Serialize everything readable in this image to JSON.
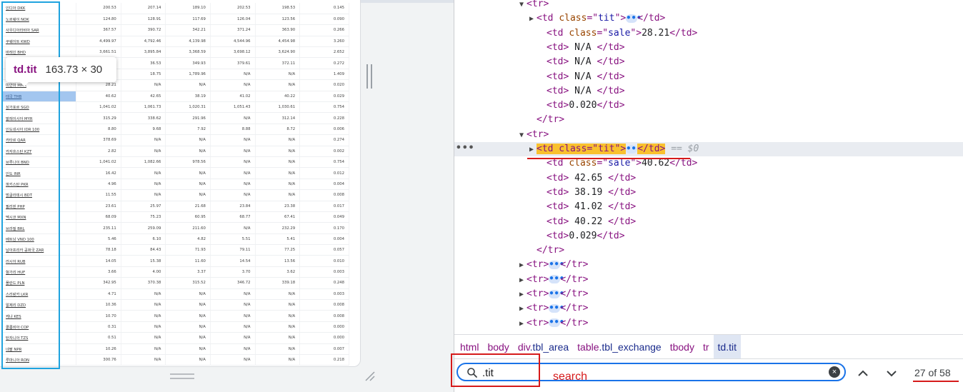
{
  "viewport": {
    "tooltip": {
      "tag": "td.tit",
      "dims": "163.73 × 30"
    },
    "rows": [
      [
        "인디아 DKK",
        "200.53",
        "207.14",
        "189.10",
        "202.53",
        "198.53",
        "0.145"
      ],
      [
        "노르웨이 NOK",
        "124.80",
        "128.91",
        "117.69",
        "126.04",
        "123.56",
        "0.090"
      ],
      [
        "사우디아라비아 SAR",
        "367.57",
        "390.72",
        "342.21",
        "371.24",
        "363.90",
        "0.266"
      ],
      [
        "쿠웨이트 KWD",
        "4,499.97",
        "4,792.46",
        "4,139.98",
        "4,544.96",
        "4,454.98",
        "3.260"
      ],
      [
        "바레인 BHD",
        "3,661.51",
        "3,895.84",
        "3,368.59",
        "3,698.12",
        "3,624.90",
        "2.652"
      ],
      [
        "",
        "",
        "36.53",
        "349.93",
        "379.61",
        "372.11",
        "0.272"
      ],
      [
        "",
        "",
        "18.75",
        "1,789.96",
        "N/A",
        "N/A",
        "1.409"
      ],
      [
        "미얀마 MMK",
        "28.21",
        "N/A",
        "N/A",
        "N/A",
        "N/A",
        "0.020"
      ],
      [
        "태국 THB",
        "40.62",
        "42.65",
        "38.19",
        "41.02",
        "40.22",
        "0.029"
      ],
      [
        "싱가포르 SGD",
        "1,041.02",
        "1,061.73",
        "1,020.31",
        "1,051.43",
        "1,030.61",
        "0.754"
      ],
      [
        "말레이시아 MYR",
        "315.29",
        "338.62",
        "291.96",
        "N/A",
        "312.14",
        "0.228"
      ],
      [
        "인도네시아 IDR 100",
        "8.80",
        "9.68",
        "7.92",
        "8.88",
        "8.72",
        "0.006"
      ],
      [
        "카타르 QAR",
        "378.69",
        "N/A",
        "N/A",
        "N/A",
        "N/A",
        "0.274"
      ],
      [
        "카자흐스탄 KZT",
        "2.82",
        "N/A",
        "N/A",
        "N/A",
        "N/A",
        "0.002"
      ],
      [
        "브루나이 BND",
        "1,041.02",
        "1,082.66",
        "978.56",
        "N/A",
        "N/A",
        "0.754"
      ],
      [
        "인도 INR",
        "16.42",
        "N/A",
        "N/A",
        "N/A",
        "N/A",
        "0.012"
      ],
      [
        "파키스탄 PKR",
        "4.96",
        "N/A",
        "N/A",
        "N/A",
        "N/A",
        "0.004"
      ],
      [
        "방글라데시 BDT",
        "11.55",
        "N/A",
        "N/A",
        "N/A",
        "N/A",
        "0.008"
      ],
      [
        "필리핀 PHP",
        "23.61",
        "25.97",
        "21.68",
        "23.84",
        "23.38",
        "0.017"
      ],
      [
        "멕시코 MXN",
        "68.09",
        "75.23",
        "60.95",
        "68.77",
        "67.41",
        "0.049"
      ],
      [
        "브라질 BRL",
        "235.11",
        "259.09",
        "211.60",
        "N/A",
        "232.29",
        "0.170"
      ],
      [
        "베트남 VND 100",
        "5.46",
        "6.10",
        "4.82",
        "5.51",
        "5.41",
        "0.004"
      ],
      [
        "남아프리카 공화국 ZAR",
        "78.18",
        "84.43",
        "71.93",
        "79.11",
        "77.25",
        "0.057"
      ],
      [
        "러시아 RUB",
        "14.05",
        "15.38",
        "11.60",
        "14.54",
        "13.56",
        "0.010"
      ],
      [
        "헝가리 HUF",
        "3.66",
        "4.00",
        "3.37",
        "3.70",
        "3.62",
        "0.003"
      ],
      [
        "폴란드 PLN",
        "342.95",
        "370.38",
        "315.52",
        "346.72",
        "339.18",
        "0.248"
      ],
      [
        "스리랑카 LKR",
        "4.71",
        "N/A",
        "N/A",
        "N/A",
        "N/A",
        "0.003"
      ],
      [
        "알제리 DZD",
        "10.36",
        "N/A",
        "N/A",
        "N/A",
        "N/A",
        "0.008"
      ],
      [
        "케냐 KES",
        "10.70",
        "N/A",
        "N/A",
        "N/A",
        "N/A",
        "0.008"
      ],
      [
        "콜롬비아 COP",
        "0.31",
        "N/A",
        "N/A",
        "N/A",
        "N/A",
        "0.000"
      ],
      [
        "탄자니아 TZS",
        "0.51",
        "N/A",
        "N/A",
        "N/A",
        "N/A",
        "0.000"
      ],
      [
        "네팔 NPR",
        "10.26",
        "N/A",
        "N/A",
        "N/A",
        "N/A",
        "0.007"
      ],
      [
        "루마니아 RON",
        "300.76",
        "N/A",
        "N/A",
        "N/A",
        "N/A",
        "0.218"
      ]
    ]
  },
  "devtools": {
    "dom_lines": [
      {
        "indent": 87,
        "tw": "▼",
        "parts": [
          [
            "tag",
            "<tr>"
          ]
        ]
      },
      {
        "indent": 101,
        "tw": "▶",
        "parts": [
          [
            "tag",
            "<td "
          ],
          [
            "attr",
            "class"
          ],
          [
            "eq",
            "=\""
          ],
          [
            "val",
            "tit"
          ],
          [
            "eq",
            "\">"
          ],
          [
            "ell",
            "•••"
          ],
          [
            "tag",
            "</td>"
          ]
        ]
      },
      {
        "indent": 115,
        "tw": "",
        "parts": [
          [
            "tag",
            "<td "
          ],
          [
            "attr",
            "class"
          ],
          [
            "eq",
            "=\""
          ],
          [
            "val",
            "sale"
          ],
          [
            "eq",
            "\">"
          ],
          [
            "txt",
            "28.21"
          ],
          [
            "tag",
            "</td>"
          ]
        ]
      },
      {
        "indent": 115,
        "tw": "",
        "parts": [
          [
            "tag",
            "<td>"
          ],
          [
            "txt",
            " N/A "
          ],
          [
            "tag",
            "</td>"
          ]
        ]
      },
      {
        "indent": 115,
        "tw": "",
        "parts": [
          [
            "tag",
            "<td>"
          ],
          [
            "txt",
            " N/A "
          ],
          [
            "tag",
            "</td>"
          ]
        ]
      },
      {
        "indent": 115,
        "tw": "",
        "parts": [
          [
            "tag",
            "<td>"
          ],
          [
            "txt",
            " N/A "
          ],
          [
            "tag",
            "</td>"
          ]
        ]
      },
      {
        "indent": 115,
        "tw": "",
        "parts": [
          [
            "tag",
            "<td>"
          ],
          [
            "txt",
            " N/A "
          ],
          [
            "tag",
            "</td>"
          ]
        ]
      },
      {
        "indent": 115,
        "tw": "",
        "parts": [
          [
            "tag",
            "<td>"
          ],
          [
            "txt",
            "0.020"
          ],
          [
            "tag",
            "</td>"
          ]
        ]
      },
      {
        "indent": 101,
        "tw": "",
        "parts": [
          [
            "tag",
            "</tr>"
          ]
        ]
      },
      {
        "indent": 87,
        "tw": "▼",
        "parts": [
          [
            "tag",
            "<tr>"
          ]
        ]
      },
      {
        "indent": 101,
        "tw": "▶",
        "selected": true,
        "parts": [
          [
            "hl",
            "<td class=\"tit\">"
          ],
          [
            "ell",
            "•••"
          ],
          [
            "hl",
            "</td>"
          ],
          [
            "dim",
            " == $0"
          ]
        ]
      },
      {
        "indent": 115,
        "tw": "",
        "parts": [
          [
            "tag",
            "<td "
          ],
          [
            "attr",
            "class"
          ],
          [
            "eq",
            "=\""
          ],
          [
            "val",
            "sale"
          ],
          [
            "eq",
            "\">"
          ],
          [
            "txt",
            "40.62"
          ],
          [
            "tag",
            "</td>"
          ]
        ]
      },
      {
        "indent": 115,
        "tw": "",
        "parts": [
          [
            "tag",
            "<td>"
          ],
          [
            "txt",
            " 42.65 "
          ],
          [
            "tag",
            "</td>"
          ]
        ]
      },
      {
        "indent": 115,
        "tw": "",
        "parts": [
          [
            "tag",
            "<td>"
          ],
          [
            "txt",
            " 38.19 "
          ],
          [
            "tag",
            "</td>"
          ]
        ]
      },
      {
        "indent": 115,
        "tw": "",
        "parts": [
          [
            "tag",
            "<td>"
          ],
          [
            "txt",
            " 41.02 "
          ],
          [
            "tag",
            "</td>"
          ]
        ]
      },
      {
        "indent": 115,
        "tw": "",
        "parts": [
          [
            "tag",
            "<td>"
          ],
          [
            "txt",
            " 40.22 "
          ],
          [
            "tag",
            "</td>"
          ]
        ]
      },
      {
        "indent": 115,
        "tw": "",
        "parts": [
          [
            "tag",
            "<td>"
          ],
          [
            "txt",
            "0.029"
          ],
          [
            "tag",
            "</td>"
          ]
        ]
      },
      {
        "indent": 101,
        "tw": "",
        "parts": [
          [
            "tag",
            "</tr>"
          ]
        ]
      },
      {
        "indent": 87,
        "tw": "▶",
        "parts": [
          [
            "tag",
            "<tr>"
          ],
          [
            "ell",
            "•••"
          ],
          [
            "tag",
            "</tr>"
          ]
        ]
      },
      {
        "indent": 87,
        "tw": "▶",
        "parts": [
          [
            "tag",
            "<tr>"
          ],
          [
            "ell",
            "•••"
          ],
          [
            "tag",
            "</tr>"
          ]
        ]
      },
      {
        "indent": 87,
        "tw": "▶",
        "parts": [
          [
            "tag",
            "<tr>"
          ],
          [
            "ell",
            "•••"
          ],
          [
            "tag",
            "</tr>"
          ]
        ]
      },
      {
        "indent": 87,
        "tw": "▶",
        "parts": [
          [
            "tag",
            "<tr>"
          ],
          [
            "ell",
            "•••"
          ],
          [
            "tag",
            "</tr>"
          ]
        ]
      },
      {
        "indent": 87,
        "tw": "▶",
        "parts": [
          [
            "tag",
            "<tr>"
          ],
          [
            "ell",
            "•••"
          ],
          [
            "tag",
            "</tr>"
          ]
        ]
      }
    ],
    "row_dots": "•••",
    "breadcrumbs": [
      {
        "name": "html",
        "cls": ""
      },
      {
        "name": "body",
        "cls": ""
      },
      {
        "name": "div",
        "cls": ".tbl_area"
      },
      {
        "name": "table",
        "cls": ".tbl_exchange"
      },
      {
        "name": "tbody",
        "cls": ""
      },
      {
        "name": "tr",
        "cls": ""
      },
      {
        "name": "td",
        "cls": ".tit",
        "current": true
      }
    ],
    "search": {
      "value": ".tit",
      "annotation": "search",
      "match_count": "27 of 58",
      "clear_glyph": "×"
    }
  },
  "colors": {
    "annotation_red": "#d61a1a",
    "column_highlight": "#1fa3df",
    "selected_node": "#f9c12e",
    "focus_blue": "#1a73e8"
  }
}
